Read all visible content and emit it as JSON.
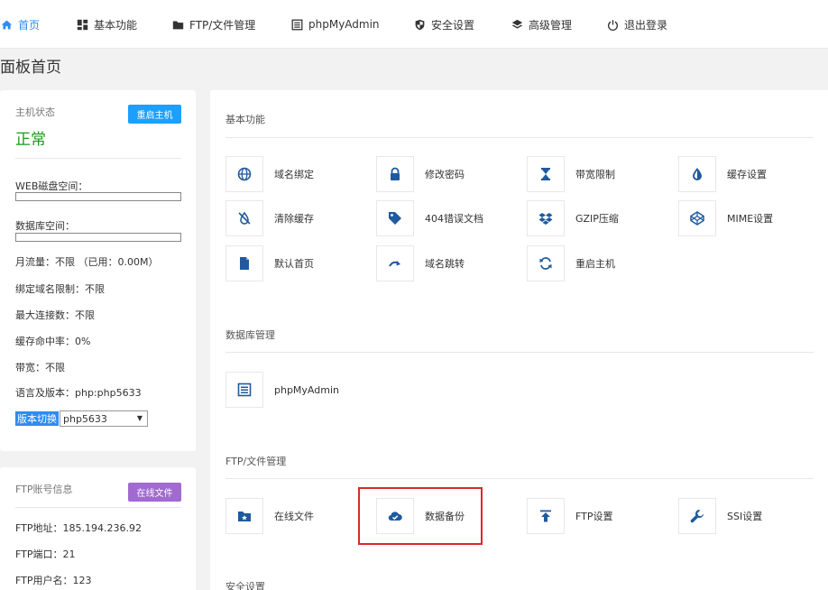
{
  "nav": {
    "home": "首页",
    "basic": "基本功能",
    "ftp": "FTP/文件管理",
    "phpmyadmin": "phpMyAdmin",
    "security": "安全设置",
    "advanced": "高级管理",
    "logout": "退出登录"
  },
  "page_title": "面板首页",
  "host": {
    "title": "主机状态",
    "restart_button": "重启主机",
    "status": "正常",
    "web_disk_label": "WEB磁盘空间：",
    "web_disk_fraction": 0,
    "db_space_label": "数据库空间：",
    "db_space_fraction": 0,
    "traffic": "月流量：不限 （已用：0.00M）",
    "domain_limit": "绑定域名限制：不限",
    "max_conn": "最大连接数：不限",
    "cache_hit": "缓存命中率：0%",
    "bandwidth": "带宽：不限",
    "lang_version": "语言及版本：php:php5633",
    "version_switch_label": "版本切换",
    "version_selected": "php5633"
  },
  "ftp_info": {
    "title": "FTP账号信息",
    "online_files_button": "在线文件",
    "address": "FTP地址：185.194.236.92",
    "port": "FTP端口：21",
    "username": "FTP用户名：123"
  },
  "sections": {
    "basic": {
      "title": "基本功能",
      "items": [
        {
          "label": "域名绑定",
          "icon": "globe-icon"
        },
        {
          "label": "修改密码",
          "icon": "lock-icon"
        },
        {
          "label": "带宽限制",
          "icon": "hourglass-icon"
        },
        {
          "label": "缓存设置",
          "icon": "drop-icon"
        },
        {
          "label": "清除缓存",
          "icon": "cache-clear-icon"
        },
        {
          "label": "404错误文档",
          "icon": "tag-icon"
        },
        {
          "label": "GZIP压缩",
          "icon": "dropbox-icon"
        },
        {
          "label": "MIME设置",
          "icon": "codepen-icon"
        },
        {
          "label": "默认首页",
          "icon": "file-icon"
        },
        {
          "label": "域名跳转",
          "icon": "redirect-icon"
        },
        {
          "label": "重启主机",
          "icon": "refresh-icon"
        }
      ]
    },
    "db": {
      "title": "数据库管理",
      "items": [
        {
          "label": "phpMyAdmin",
          "icon": "list-alt-icon"
        }
      ]
    },
    "ftp": {
      "title": "FTP/文件管理",
      "items": [
        {
          "label": "在线文件",
          "icon": "folder-star-icon"
        },
        {
          "label": "数据备份",
          "icon": "cloud-check-icon"
        },
        {
          "label": "FTP设置",
          "icon": "upload-icon"
        },
        {
          "label": "SSI设置",
          "icon": "wrench-icon"
        }
      ]
    },
    "security": {
      "title": "安全设置"
    }
  },
  "colors": {
    "accent": "#2d8cf0",
    "button_blue": "#1e9fff",
    "button_purple": "#a06ad0",
    "status_green": "#1a9a1a",
    "highlight_red": "#d9292c"
  }
}
